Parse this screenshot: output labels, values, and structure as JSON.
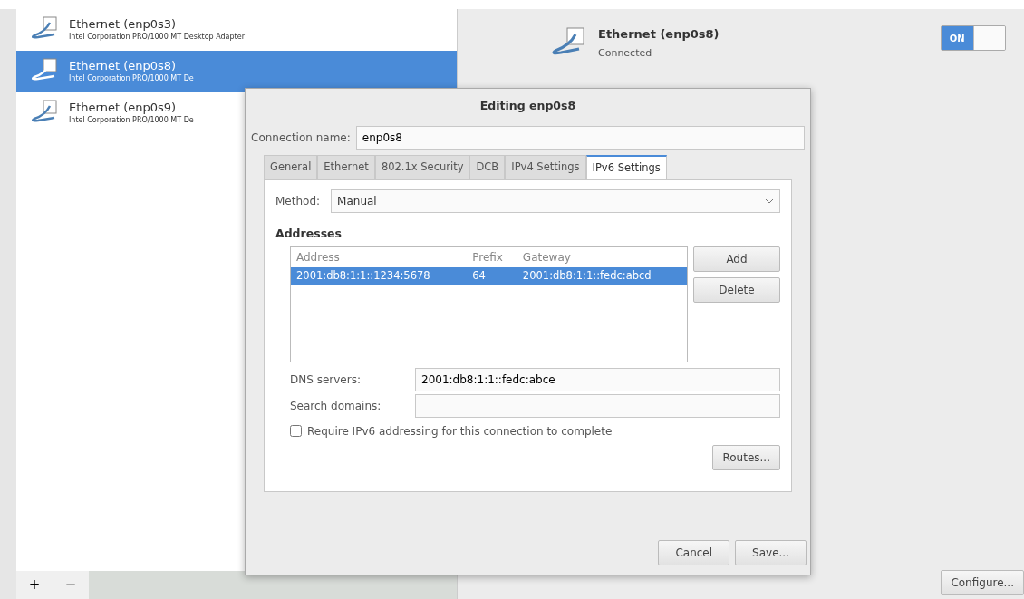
{
  "sidebar": {
    "items": [
      {
        "name": "Ethernet (enp0s3)",
        "description": "Intel Corporation PRO/1000 MT Desktop Adapter",
        "selected": false
      },
      {
        "name": "Ethernet (enp0s8)",
        "description": "Intel Corporation PRO/1000 MT De",
        "selected": true
      },
      {
        "name": "Ethernet (enp0s9)",
        "description": "Intel Corporation PRO/1000 MT De",
        "selected": false
      }
    ],
    "toolbar": [
      "+",
      "−"
    ]
  },
  "detail": {
    "title": "Ethernet (enp0s8)",
    "status": "Connected",
    "toggle": {
      "label": "ON",
      "on": true
    },
    "configure_button": "Configure..."
  },
  "dialog": {
    "title": "Editing enp0s8",
    "connection_name_label": "Connection name:",
    "connection_name": "enp0s8",
    "tabs": [
      {
        "label": "General",
        "selected": false
      },
      {
        "label": "Ethernet",
        "selected": false
      },
      {
        "label": "802.1x Security",
        "selected": false
      },
      {
        "label": "DCB",
        "selected": false
      },
      {
        "label": "IPv4 Settings",
        "selected": false
      },
      {
        "label": "IPv6 Settings",
        "selected": true
      }
    ],
    "method_label": "Method:",
    "method": "Manual",
    "addresses_heading": "Addresses",
    "table": {
      "columns": [
        "Address",
        "Prefix",
        "Gateway"
      ],
      "rows": [
        {
          "cells": [
            "2001:db8:1:1::1234:5678",
            "64",
            "2001:db8:1:1::fedc:abcd"
          ],
          "selected": true
        }
      ]
    },
    "add_button": "Add",
    "delete_button": "Delete",
    "dns_label": "DNS servers:",
    "dns": "2001:db8:1:1::fedc:abce",
    "search_label": "Search domains:",
    "require_checkbox": {
      "label": "Require IPv6 addressing for this connection to complete",
      "checked": false
    },
    "routes_button": "Routes...",
    "cancel_button": "Cancel",
    "save_button": "Save..."
  }
}
